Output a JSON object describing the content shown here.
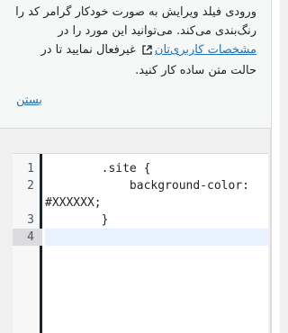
{
  "notice": {
    "text_before_link": "ورودی فیلد ویرایش به صورت خودکار گرامر کد را رنگ‌بندی می‌کند. می‌توانید این مورد را در",
    "link_label": "مشخصات کاربری‌تان",
    "text_after_link": "غیرفعال نمایید تا در حالت متن ساده کار کنید.",
    "close_label": "بستن"
  },
  "editor": {
    "line_numbers": [
      "1",
      "2",
      "3",
      "4"
    ],
    "lines": [
      "        .site {",
      "            background-color:",
      "#XXXXXX;",
      "        }",
      ""
    ]
  }
}
